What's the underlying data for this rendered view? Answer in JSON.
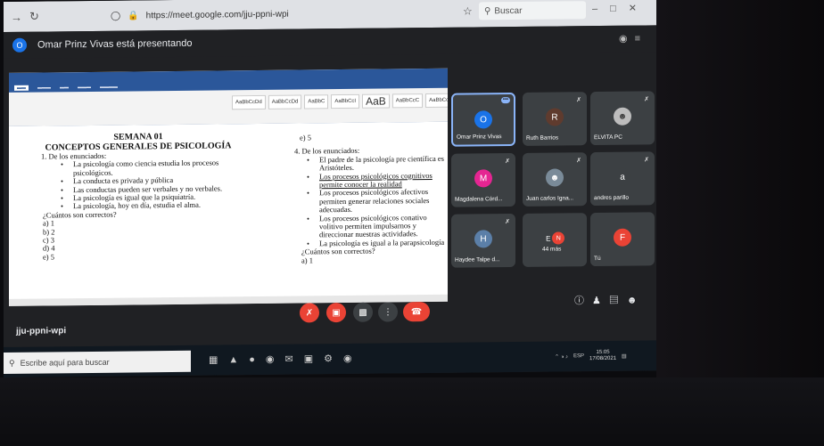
{
  "browser": {
    "url": "https://meet.google.com/jju-ppni-wpi",
    "search_placeholder": "Buscar"
  },
  "meet": {
    "presenting_initial": "O",
    "presenting_text": "Omar Prinz Vivas está presentando",
    "meeting_code": "jju-ppni-wpi"
  },
  "document": {
    "week": "SEMANA 01",
    "heading": "CONCEPTOS GENERALES DE PSICOLOGÍA",
    "q1": {
      "title": "1.   De los enunciados:",
      "items": [
        "La psicología como ciencia estudia los procesos psicológicos.",
        "La conducta es privada y pública",
        "Las conductas pueden ser verbales y no verbales.",
        "La psicología es igual que la psiquiatría.",
        "La psicología, hoy en día, estudia el alma."
      ],
      "prompt": "¿Cuántos son correctos?",
      "options": [
        "a)   1",
        "b)   2",
        "c)   3",
        "d)   4",
        "e)   5"
      ]
    },
    "q4": {
      "top_option": "e)   5",
      "title": "4.   De los enunciados:",
      "items": [
        "El padre de la psicología pre científica es Aristóteles.",
        "Los procesos psicológicos cognitivos permite conocer la realidad",
        "Los procesos psicológicos afectivos permiten generar relaciones sociales adecuadas.",
        "Los procesos psicológicos conativo volitivo permiten impulsarnos y direccionar nuestras actividades.",
        "La psicología es igual a la parapsicología"
      ],
      "prompt": "¿Cuántos son correctos?",
      "options": [
        "a)   1"
      ]
    }
  },
  "participants": [
    {
      "initial": "O",
      "name": "Omar Prinz Vivas",
      "color": "#1a73e8",
      "active": true
    },
    {
      "initial": "R",
      "name": "Ruth Barrios",
      "color": "#5f3b2e"
    },
    {
      "initial": "",
      "name": "ELVITA PC",
      "color": "#bdbdbd"
    },
    {
      "initial": "M",
      "name": "Magdalena Córd...",
      "color": "#e52592"
    },
    {
      "initial": "",
      "name": "Juan carlos Igna...",
      "color": "#7a8b99"
    },
    {
      "initial": "a",
      "name": "andres parillo",
      "color": "#3c4043"
    },
    {
      "initial": "H",
      "name": "Haydee Talpe d...",
      "color": "#5b7fa8"
    },
    {
      "initial": "E",
      "name": "44 más",
      "color": "#3c4043"
    },
    {
      "initial": "F",
      "name": "Tú",
      "color": "#ea4335"
    }
  ],
  "taskbar": {
    "search_placeholder": "Escribe aquí para buscar",
    "lang": "ESP",
    "time": "15:05",
    "date": "17/08/2021"
  },
  "colors": {
    "meet_bg": "#202124",
    "tile_bg": "#3c4043",
    "red": "#ea4335",
    "accent": "#1a73e8"
  }
}
